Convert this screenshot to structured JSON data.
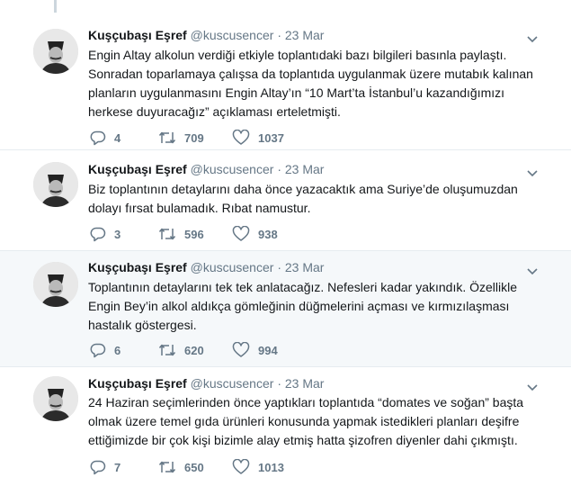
{
  "tweets": [
    {
      "author_name": "Kuşçubaşı Eşref",
      "handle": "@kuscusencer",
      "separator": "·",
      "date": "23 Mar",
      "text": "Engin Altay alkolun verdiği etkiyle toplantıdaki bazı bilgileri basınla paylaştı.\nSonradan toparlamaya çalışsa da toplantıda uygulanmak üzere mutabık kalınan\nplanların uygulanmasını Engin Altay’ın “10 Mart’ta İstanbul’u kazandığımızı\nherkese duyuracağız” açıklaması erteletmişti.",
      "replies": "4",
      "retweets": "709",
      "likes": "1037"
    },
    {
      "author_name": "Kuşçubaşı Eşref",
      "handle": "@kuscusencer",
      "separator": "·",
      "date": "23 Mar",
      "text": "Biz toplantının detaylarını daha önce yazacaktık ama Suriye’de oluşumuzdan\ndolayı fırsat bulamadık. Rıbat namustur.",
      "replies": "3",
      "retweets": "596",
      "likes": "938"
    },
    {
      "author_name": "Kuşçubaşı Eşref",
      "handle": "@kuscusencer",
      "separator": "·",
      "date": "23 Mar",
      "text": "Toplantının detaylarını tek tek anlatacağız. Nefesleri kadar yakındık. Özellikle\nEngin Bey’in alkol aldıkça gömleğinin düğmelerini açması ve kırmızılaşması\nhastalık göstergesi.",
      "replies": "6",
      "retweets": "620",
      "likes": "994"
    },
    {
      "author_name": "Kuşçubaşı Eşref",
      "handle": "@kuscusencer",
      "separator": "·",
      "date": "23 Mar",
      "text": "24 Haziran seçimlerinden önce yaptıkları toplantıda “domates ve soğan” başta\nolmak üzere temel gıda ürünleri konusunda yapmak istedikleri planları deşifre\nettiğimizde bir çok kişi bizimle alay etmiş hatta şizofren diyenler dahi çıkmıştı.",
      "replies": "7",
      "retweets": "650",
      "likes": "1013"
    }
  ],
  "icons": {
    "reply": "reply-icon",
    "retweet": "retweet-icon",
    "like": "heart-icon",
    "caret": "chevron-down-icon"
  },
  "colors": {
    "text": "#14171a",
    "muted": "#657786",
    "highlight_bg": "#f5f8fa",
    "divider": "#e6ecf0"
  }
}
